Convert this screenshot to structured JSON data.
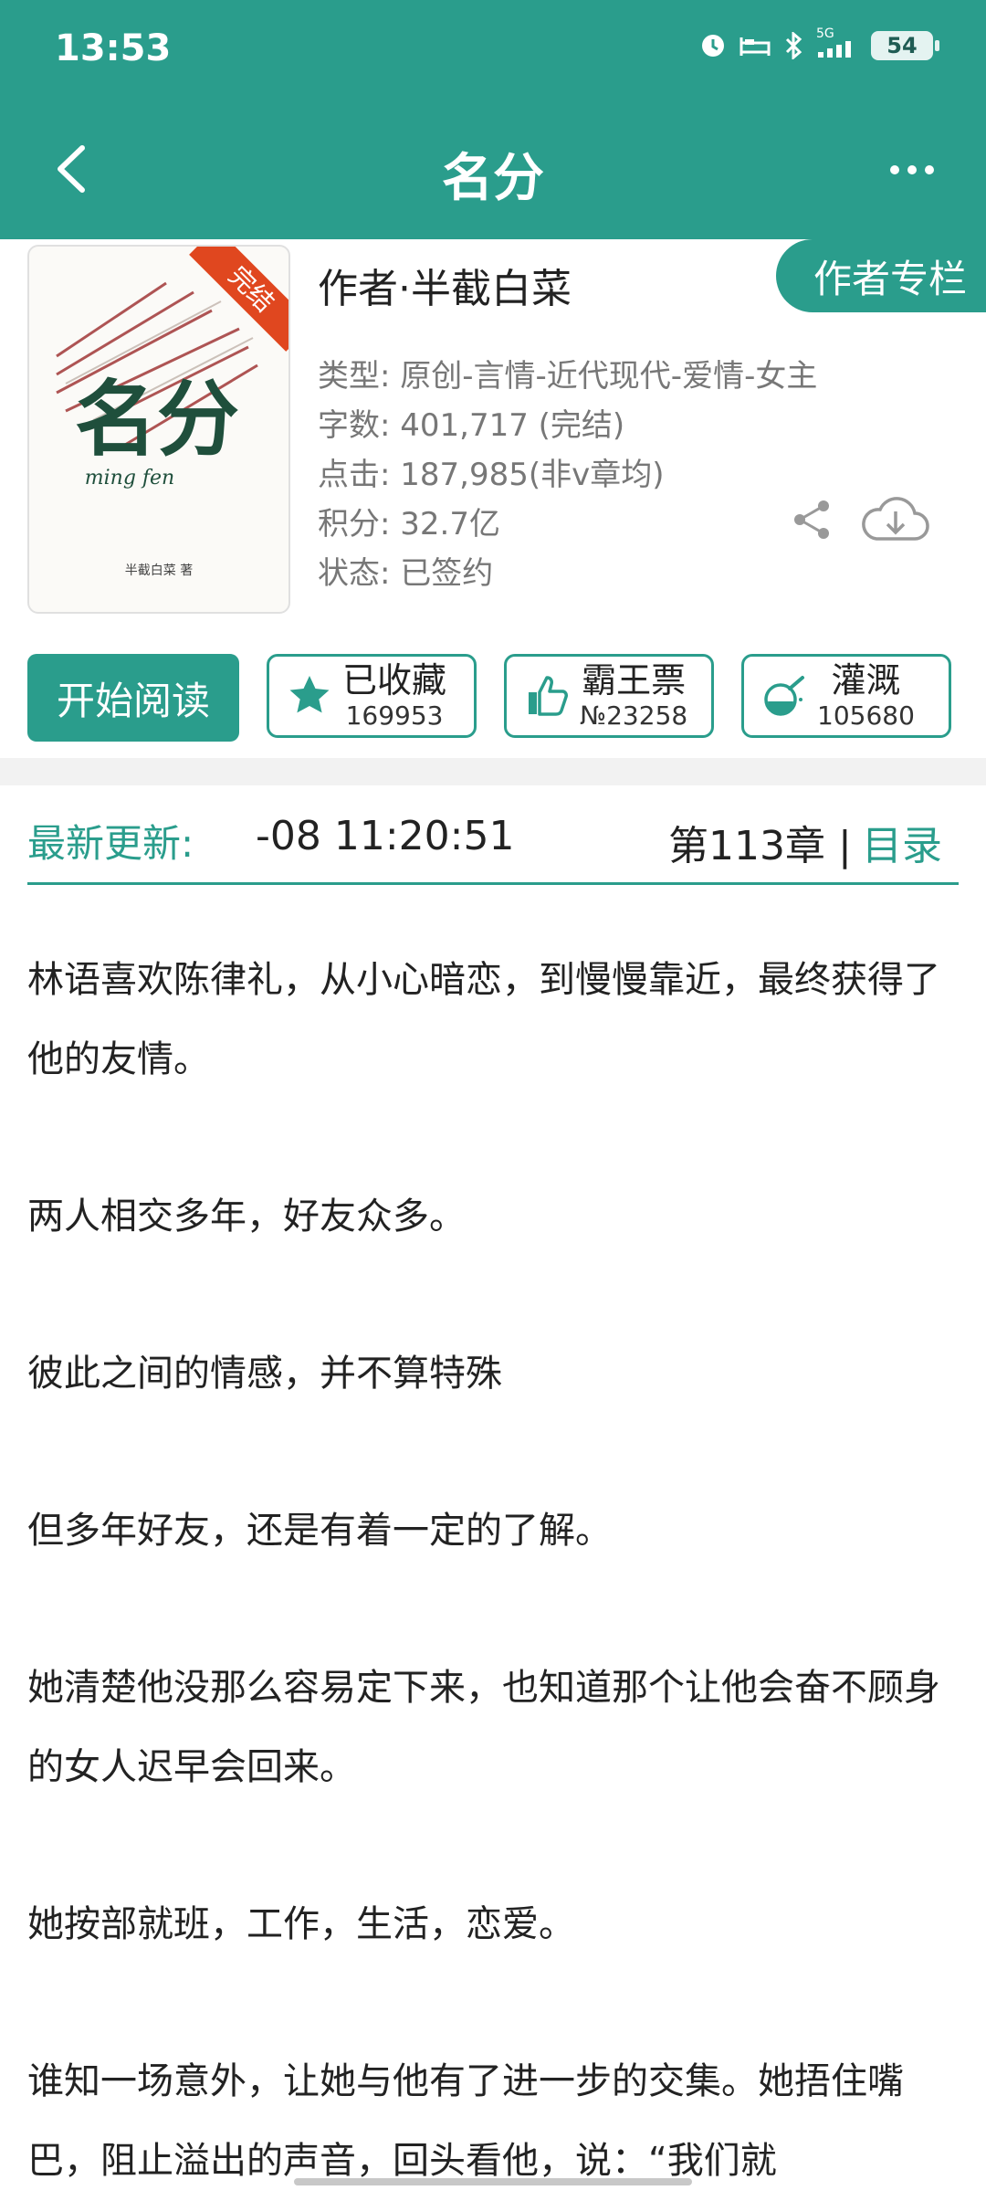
{
  "status_bar": {
    "time": "13:53",
    "network": "5G",
    "battery": "54"
  },
  "header": {
    "title": "名分"
  },
  "book": {
    "cover_title": "名分",
    "cover_badge": "完结",
    "cover_author": "半截白菜 著",
    "author": "作者·半截白菜",
    "author_column_button": "作者专栏",
    "type": "类型: 原创-言情-近代现代-爱情-女主",
    "word_count": "字数: 401,717 (完结)",
    "clicks": "点击: 187,985(非v章均)",
    "points": "积分: 32.7亿",
    "status": "状态: 已签约"
  },
  "actions": {
    "read": "开始阅读",
    "favorite": {
      "label": "已收藏",
      "count": "169953"
    },
    "vote": {
      "label": "霸王票",
      "count": "№23258"
    },
    "nutrient": {
      "label": "灌溉",
      "count": "105680"
    }
  },
  "update": {
    "label": "最新更新:",
    "time": "-08 11:20:51",
    "chapter": "第113章 |",
    "catalog": "目录"
  },
  "synopsis": [
    "林语喜欢陈律礼，从小心暗恋，到慢慢靠近，最终获得了他的友情。",
    "两人相交多年，好友众多。",
    "彼此之间的情感，并不算特殊",
    "但多年好友，还是有着一定的了解。",
    "她清楚他没那么容易定下来，也知道那个让他会奋不顾身的女人迟早会回来。",
    "她按部就班，工作，生活，恋爱。",
    "谁知一场意外，让她与他有了进一步的交集。她捂住嘴巴，阻止溢出的声音，回头看他，说：“我们就"
  ],
  "colors": {
    "accent": "#2a9d8c",
    "badge": "#e0471f"
  }
}
